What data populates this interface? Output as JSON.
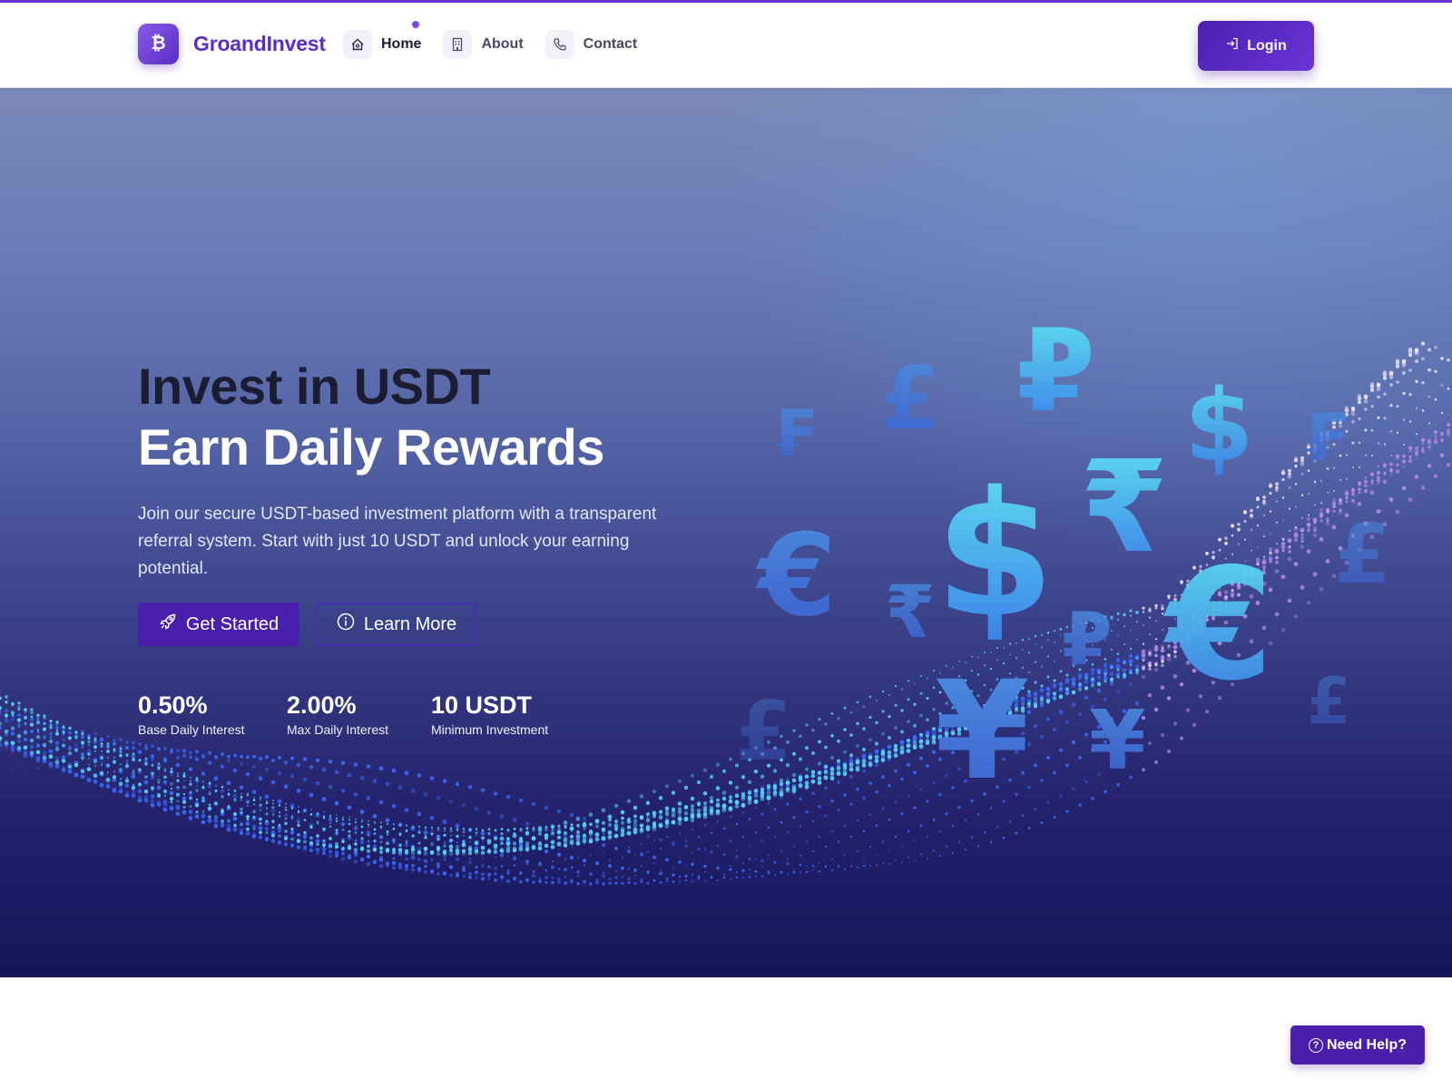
{
  "brand": {
    "logo_glyph": "₿",
    "name": "GroandInvest",
    "accent": "#5b2dc7"
  },
  "nav": {
    "items": [
      {
        "label": "Home",
        "icon": "home-icon",
        "active": true
      },
      {
        "label": "About",
        "icon": "building-icon",
        "active": false
      },
      {
        "label": "Contact",
        "icon": "phone-icon",
        "active": false
      }
    ],
    "login_label": "Login"
  },
  "hero": {
    "headline_line1": "Invest in USDT",
    "headline_line2": "Earn Daily Rewards",
    "description": "Join our secure USDT-based investment platform with a transparent referral system. Start with just 10 USDT and unlock your earning potential.",
    "primary_button": "Get Started",
    "secondary_button": "Learn More",
    "stats": [
      {
        "value": "0.50%",
        "label": "Base Daily Interest"
      },
      {
        "value": "2.00%",
        "label": "Max Daily Interest"
      },
      {
        "value": "10 USDT",
        "label": "Minimum Investment"
      }
    ],
    "currency_symbols": [
      "₣",
      "£",
      "₽",
      "$",
      "₣",
      "₹",
      "$",
      "€",
      "₹",
      "₽",
      "€",
      "£",
      "¥",
      "¥",
      "£",
      "£"
    ]
  },
  "help": {
    "label": "Need Help?",
    "icon": "question-circle-icon"
  },
  "colors": {
    "primary": "#4a1fae",
    "top_line": "#6b35d6"
  }
}
